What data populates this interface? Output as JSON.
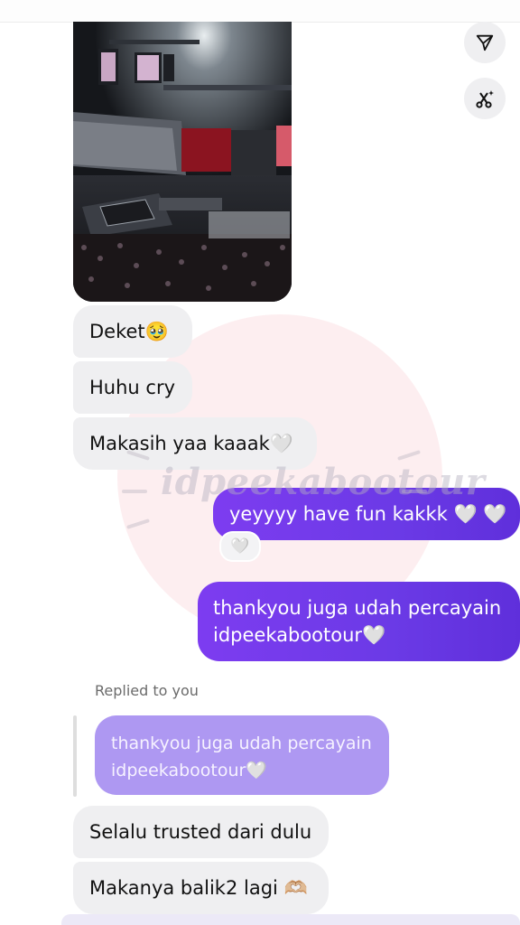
{
  "messages": {
    "m1": "Deket",
    "m1_emoji": "🥹",
    "m2": "Huhu cry",
    "m3": "Makasih yaa kaaak",
    "m3_heart": "🤍",
    "m4": "yeyyyy have fun kakkk",
    "m4_hearts": "🤍 🤍",
    "m4_reaction": "🤍",
    "m5_line1": "thankyou juga udah percayain",
    "m5_line2": "idpeekabootour",
    "m5_heart": "🤍",
    "replied_label": "Replied to you",
    "reply_line1": "thankyou juga udah percayain",
    "reply_line2": "idpeekabootour",
    "reply_heart": "🤍",
    "m6": "Selalu trusted dari dulu",
    "m7": "Makanya balik2 lagi",
    "m7_emoji": "🫶🏼"
  },
  "actions": {
    "share_icon": "paper-plane-icon",
    "ai_icon": "scissors-sparkle-icon"
  },
  "watermark": {
    "text": "idpeekabootour"
  },
  "colors": {
    "incoming_bubble": "#efeff1",
    "outgoing_bubble": "#6b3ae6",
    "reply_preview": "#ae98f2"
  }
}
